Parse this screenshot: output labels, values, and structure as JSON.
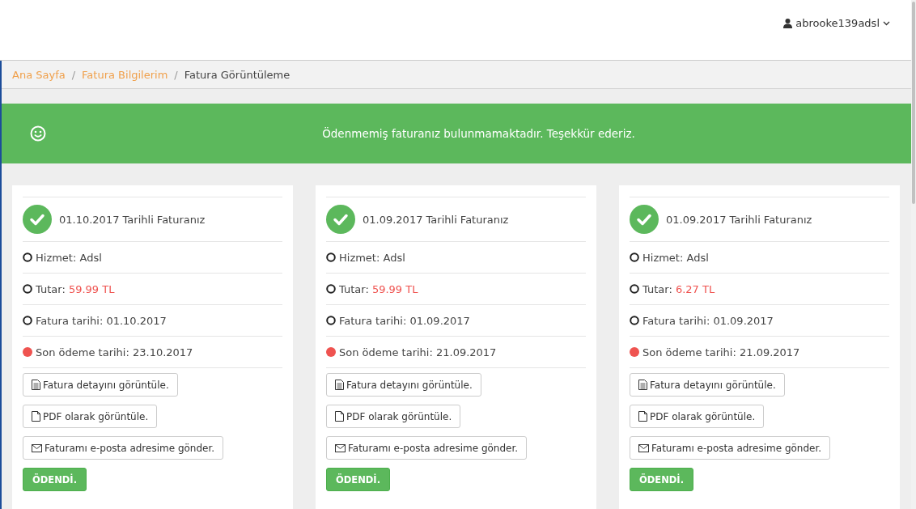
{
  "header": {
    "user": "abrooke139adsl"
  },
  "breadcrumb_separator": "/",
  "breadcrumb": [
    {
      "label": "Ana Sayfa",
      "kind": "link"
    },
    {
      "label": "Fatura Bilgilerim",
      "kind": "link"
    },
    {
      "label": "Fatura Görüntüleme",
      "kind": "current"
    }
  ],
  "alert": {
    "message": "Ödenmemiş faturanız bulunmamaktadır. Teşekkür ederiz."
  },
  "invoices": [
    {
      "title": "01.10.2017 Tarihli Faturanız",
      "paid_label": "ÖDENDİ.",
      "items": [
        {
          "kind": "circle",
          "label": "Hizmet: Adsl"
        },
        {
          "kind": "circle",
          "label": "Tutar:",
          "value": "59.99 TL"
        },
        {
          "kind": "circle",
          "label": "Fatura tarihi: 01.10.2017"
        },
        {
          "kind": "dot",
          "label": "Son ödeme tarihi: 23.10.2017"
        }
      ],
      "actions": [
        {
          "kind": "detail",
          "label": "Fatura detayını görüntüle."
        },
        {
          "kind": "pdf",
          "label": "PDF olarak görüntüle."
        },
        {
          "kind": "mail",
          "label": "Faturamı e-posta adresime gönder."
        }
      ]
    },
    {
      "title": "01.09.2017 Tarihli Faturanız",
      "paid_label": "ÖDENDİ.",
      "items": [
        {
          "kind": "circle",
          "label": "Hizmet: Adsl"
        },
        {
          "kind": "circle",
          "label": "Tutar:",
          "value": "59.99 TL"
        },
        {
          "kind": "circle",
          "label": "Fatura tarihi: 01.09.2017"
        },
        {
          "kind": "dot",
          "label": "Son ödeme tarihi: 21.09.2017"
        }
      ],
      "actions": [
        {
          "kind": "detail",
          "label": "Fatura detayını görüntüle."
        },
        {
          "kind": "pdf",
          "label": "PDF olarak görüntüle."
        },
        {
          "kind": "mail",
          "label": "Faturamı e-posta adresime gönder."
        }
      ]
    },
    {
      "title": "01.09.2017 Tarihli Faturanız",
      "paid_label": "ÖDENDİ.",
      "items": [
        {
          "kind": "circle",
          "label": "Hizmet: Adsl"
        },
        {
          "kind": "circle",
          "label": "Tutar:",
          "value": "6.27 TL"
        },
        {
          "kind": "circle",
          "label": "Fatura tarihi: 01.09.2017"
        },
        {
          "kind": "dot",
          "label": "Son ödeme tarihi: 21.09.2017"
        }
      ],
      "actions": [
        {
          "kind": "detail",
          "label": "Fatura detayını görüntüle."
        },
        {
          "kind": "pdf",
          "label": "PDF olarak görüntüle."
        },
        {
          "kind": "mail",
          "label": "Faturamı e-posta adresime gönder."
        }
      ]
    }
  ]
}
